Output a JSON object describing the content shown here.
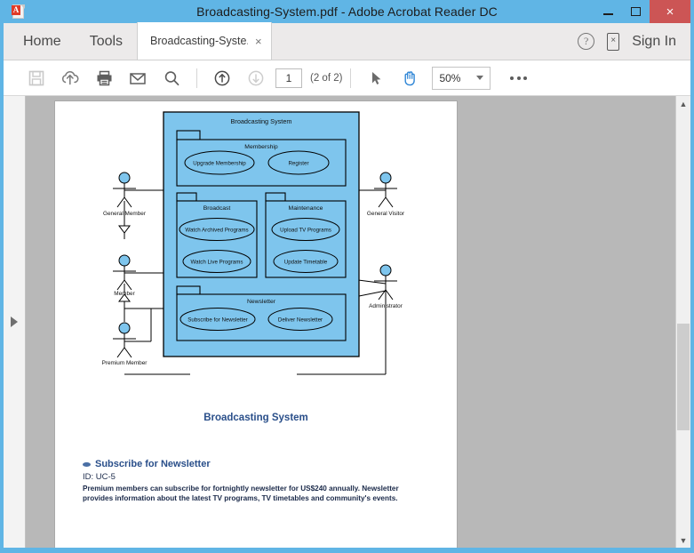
{
  "window": {
    "title": "Broadcasting-System.pdf - Adobe Acrobat Reader DC",
    "minimize_label": "–",
    "maximize_label": "",
    "close_label": "×"
  },
  "tabs": {
    "home": "Home",
    "tools": "Tools",
    "document": "Broadcasting-Syste...",
    "document_close": "×",
    "sign_in": "Sign In",
    "help_glyph": "?",
    "mobile_glyph": "×"
  },
  "toolbar": {
    "save": "save-icon",
    "upload": "cloud-upload-icon",
    "print": "print-icon",
    "email": "email-icon",
    "search": "search-icon",
    "prev_page": "previous-page-icon",
    "next_page": "next-page-icon",
    "page_value": "1",
    "page_count": "(2 of 2)",
    "select_tool": "select-arrow-icon",
    "hand_tool": "hand-tool-icon",
    "zoom_value": "50%",
    "more": "more-options-icon"
  },
  "document": {
    "caption": "Broadcasting System",
    "usecase_title": "Subscribe for Newsletter",
    "usecase_id": "ID: UC-5",
    "usecase_description": "Premium members can subscribe for fortnightly newsletter for US$240 annually. Newsletter provides information about the latest TV programs, TV timetables and community's events."
  },
  "diagram": {
    "system_name": "Broadcasting System",
    "packages": [
      {
        "name": "Membership",
        "usecases": [
          "Upgrade Membership",
          "Register"
        ]
      },
      {
        "name": "Broadcast",
        "usecases": [
          "Watch Archived Programs",
          "Watch Live Programs"
        ]
      },
      {
        "name": "Maintenance",
        "usecases": [
          "Upload TV Programs",
          "Update Timetable"
        ]
      },
      {
        "name": "Newsletter",
        "usecases": [
          "Subscribe for Newsletter",
          "Deliver Newsletter"
        ]
      }
    ],
    "actors": [
      {
        "name": "General Member",
        "side": "left"
      },
      {
        "name": "Member",
        "side": "left"
      },
      {
        "name": "Premium Member",
        "side": "left"
      },
      {
        "name": "General Visitor",
        "side": "right"
      },
      {
        "name": "Administrator",
        "side": "right"
      }
    ],
    "colors": {
      "system_fill": "#7ec5ed",
      "usecase_fill": "#7ec5ed",
      "actor_head": "#7ec5ed",
      "stroke": "#000000"
    }
  }
}
